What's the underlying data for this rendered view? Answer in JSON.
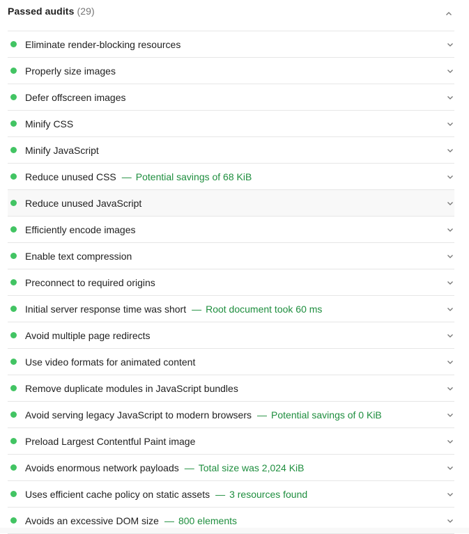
{
  "group": {
    "title": "Passed audits",
    "count": "(29)",
    "expanded": true
  },
  "colors": {
    "pass": "#42c463",
    "display_value": "#1e8e3e",
    "separator": "#e6e6e6"
  },
  "audits": [
    {
      "title": "Eliminate render-blocking resources",
      "display": ""
    },
    {
      "title": "Properly size images",
      "display": ""
    },
    {
      "title": "Defer offscreen images",
      "display": ""
    },
    {
      "title": "Minify CSS",
      "display": ""
    },
    {
      "title": "Minify JavaScript",
      "display": ""
    },
    {
      "title": "Reduce unused CSS",
      "display": "Potential savings of 68 KiB"
    },
    {
      "title": "Reduce unused JavaScript",
      "display": "",
      "hovered": true
    },
    {
      "title": "Efficiently encode images",
      "display": ""
    },
    {
      "title": "Enable text compression",
      "display": ""
    },
    {
      "title": "Preconnect to required origins",
      "display": ""
    },
    {
      "title": "Initial server response time was short",
      "display": "Root document took 60 ms"
    },
    {
      "title": "Avoid multiple page redirects",
      "display": ""
    },
    {
      "title": "Use video formats for animated content",
      "display": ""
    },
    {
      "title": "Remove duplicate modules in JavaScript bundles",
      "display": ""
    },
    {
      "title": "Avoid serving legacy JavaScript to modern browsers",
      "display": "Potential savings of 0 KiB"
    },
    {
      "title": "Preload Largest Contentful Paint image",
      "display": ""
    },
    {
      "title": "Avoids enormous network payloads",
      "display": "Total size was 2,024 KiB"
    },
    {
      "title": "Uses efficient cache policy on static assets",
      "display": "3 resources found"
    },
    {
      "title": "Avoids an excessive DOM size",
      "display": "800 elements"
    }
  ],
  "separator_glyph": "—"
}
